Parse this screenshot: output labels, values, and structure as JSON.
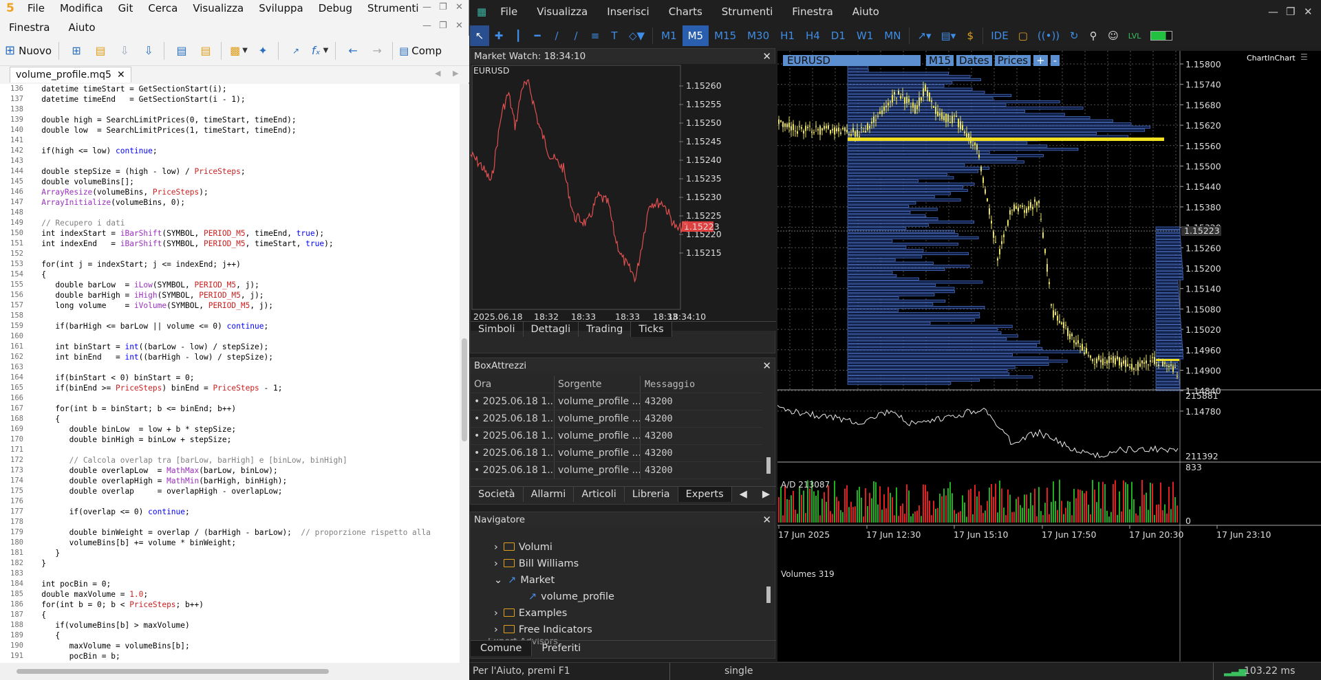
{
  "editor": {
    "logo": "5",
    "menu": [
      "File",
      "Modifica",
      "Git",
      "Cerca",
      "Visualizza",
      "Sviluppa",
      "Debug",
      "Strumenti"
    ],
    "menu2": [
      "Finestra",
      "Aiuto"
    ],
    "toolbar": {
      "new_label": "Nuovo",
      "compile_label": "Comp"
    },
    "file_tab": "volume_profile.mq5",
    "lines": [
      {
        "n": "136",
        "t": [
          [
            "",
            "   datetime timeStart = GetSectionStart(i);"
          ]
        ]
      },
      {
        "n": "137",
        "t": [
          [
            "",
            "   datetime timeEnd   = GetSectionStart(i - 1);"
          ]
        ]
      },
      {
        "n": "138",
        "t": []
      },
      {
        "n": "139",
        "t": [
          [
            "",
            "   double high = SearchLimitPrices(0, timeStart, timeEnd);"
          ]
        ]
      },
      {
        "n": "140",
        "t": [
          [
            "",
            "   double low  = SearchLimitPrices(1, timeStart, timeEnd);"
          ]
        ]
      },
      {
        "n": "141",
        "t": []
      },
      {
        "n": "142",
        "t": [
          [
            "",
            "   if(high <= low) "
          ],
          [
            "kw",
            "continue"
          ],
          [
            "",
            ";"
          ]
        ]
      },
      {
        "n": "143",
        "t": []
      },
      {
        "n": "144",
        "t": [
          [
            "",
            "   double stepSize = (high - low) / "
          ],
          [
            "cn",
            "PriceSteps"
          ],
          [
            "",
            ";"
          ]
        ]
      },
      {
        "n": "145",
        "t": [
          [
            "",
            "   double volumeBins[];"
          ]
        ]
      },
      {
        "n": "146",
        "t": [
          [
            "fn",
            "   ArrayResize"
          ],
          [
            "",
            "(volumeBins, "
          ],
          [
            "cn",
            "PriceSteps"
          ],
          [
            "",
            ");"
          ]
        ]
      },
      {
        "n": "147",
        "t": [
          [
            "fn",
            "   ArrayInitialize"
          ],
          [
            "",
            "(volumeBins, 0);"
          ]
        ]
      },
      {
        "n": "148",
        "t": []
      },
      {
        "n": "149",
        "t": [
          [
            "cm",
            "   // Recupero i dati"
          ]
        ]
      },
      {
        "n": "150",
        "t": [
          [
            "",
            "   int indexStart = "
          ],
          [
            "fn",
            "iBarShift"
          ],
          [
            "",
            "(SYMBOL, "
          ],
          [
            "cn",
            "PERIOD_M5"
          ],
          [
            "",
            ", timeEnd, "
          ],
          [
            "kw",
            "true"
          ],
          [
            "",
            ");"
          ]
        ]
      },
      {
        "n": "151",
        "t": [
          [
            "",
            "   int indexEnd   = "
          ],
          [
            "fn",
            "iBarShift"
          ],
          [
            "",
            "(SYMBOL, "
          ],
          [
            "cn",
            "PERIOD_M5"
          ],
          [
            "",
            ", timeStart, "
          ],
          [
            "kw",
            "true"
          ],
          [
            "",
            ");"
          ]
        ]
      },
      {
        "n": "152",
        "t": []
      },
      {
        "n": "153",
        "t": [
          [
            "",
            "   for(int j = indexStart; j <= indexEnd; j++)"
          ]
        ]
      },
      {
        "n": "154",
        "t": [
          [
            "",
            "   {"
          ]
        ]
      },
      {
        "n": "155",
        "t": [
          [
            "",
            "      double barLow  = "
          ],
          [
            "fn",
            "iLow"
          ],
          [
            "",
            "(SYMBOL, "
          ],
          [
            "cn",
            "PERIOD_M5"
          ],
          [
            "",
            ", j);"
          ]
        ]
      },
      {
        "n": "156",
        "t": [
          [
            "",
            "      double barHigh = "
          ],
          [
            "fn",
            "iHigh"
          ],
          [
            "",
            "(SYMBOL, "
          ],
          [
            "cn",
            "PERIOD_M5"
          ],
          [
            "",
            ", j);"
          ]
        ]
      },
      {
        "n": "157",
        "t": [
          [
            "",
            "      long volume    = "
          ],
          [
            "fn",
            "iVolume"
          ],
          [
            "",
            "(SYMBOL, "
          ],
          [
            "cn",
            "PERIOD_M5"
          ],
          [
            "",
            ", j);"
          ]
        ]
      },
      {
        "n": "158",
        "t": []
      },
      {
        "n": "159",
        "t": [
          [
            "",
            "      if(barHigh <= barLow || volume <= 0) "
          ],
          [
            "kw",
            "continue"
          ],
          [
            "",
            ";"
          ]
        ]
      },
      {
        "n": "160",
        "t": []
      },
      {
        "n": "161",
        "t": [
          [
            "",
            "      int binStart = "
          ],
          [
            "kw",
            "int"
          ],
          [
            "",
            "((barLow - low) / stepSize);"
          ]
        ]
      },
      {
        "n": "162",
        "t": [
          [
            "",
            "      int binEnd   = "
          ],
          [
            "kw",
            "int"
          ],
          [
            "",
            "((barHigh - low) / stepSize);"
          ]
        ]
      },
      {
        "n": "163",
        "t": []
      },
      {
        "n": "164",
        "t": [
          [
            "",
            "      if(binStart < 0) binStart = 0;"
          ]
        ]
      },
      {
        "n": "165",
        "t": [
          [
            "",
            "      if(binEnd >= "
          ],
          [
            "cn",
            "PriceSteps"
          ],
          [
            "",
            ") binEnd = "
          ],
          [
            "cn",
            "PriceSteps"
          ],
          [
            "",
            " - 1;"
          ]
        ]
      },
      {
        "n": "166",
        "t": []
      },
      {
        "n": "167",
        "t": [
          [
            "",
            "      for(int b = binStart; b <= binEnd; b++)"
          ]
        ]
      },
      {
        "n": "168",
        "t": [
          [
            "",
            "      {"
          ]
        ]
      },
      {
        "n": "169",
        "t": [
          [
            "",
            "         double binLow  = low + b * stepSize;"
          ]
        ]
      },
      {
        "n": "170",
        "t": [
          [
            "",
            "         double binHigh = binLow + stepSize;"
          ]
        ]
      },
      {
        "n": "171",
        "t": []
      },
      {
        "n": "172",
        "t": [
          [
            "cm",
            "         // Calcola overlap tra [barLow, barHigh] e [binLow, binHigh]"
          ]
        ]
      },
      {
        "n": "173",
        "t": [
          [
            "",
            "         double overlapLow  = "
          ],
          [
            "fn",
            "MathMax"
          ],
          [
            "",
            "(barLow, binLow);"
          ]
        ]
      },
      {
        "n": "174",
        "t": [
          [
            "",
            "         double overlapHigh = "
          ],
          [
            "fn",
            "MathMin"
          ],
          [
            "",
            "(barHigh, binHigh);"
          ]
        ]
      },
      {
        "n": "175",
        "t": [
          [
            "",
            "         double overlap     = overlapHigh - overlapLow;"
          ]
        ]
      },
      {
        "n": "176",
        "t": []
      },
      {
        "n": "177",
        "t": [
          [
            "",
            "         if(overlap <= 0) "
          ],
          [
            "kw",
            "continue"
          ],
          [
            "",
            ";"
          ]
        ]
      },
      {
        "n": "178",
        "t": []
      },
      {
        "n": "179",
        "t": [
          [
            "",
            "         double binWeight = overlap / (barHigh - barLow);  "
          ],
          [
            "cm",
            "// proporzione rispetto alla"
          ]
        ]
      },
      {
        "n": "180",
        "t": [
          [
            "",
            "         volumeBins[b] += volume * binWeight;"
          ]
        ]
      },
      {
        "n": "181",
        "t": [
          [
            "",
            "      }"
          ]
        ]
      },
      {
        "n": "182",
        "t": [
          [
            "",
            "   }"
          ]
        ]
      },
      {
        "n": "183",
        "t": []
      },
      {
        "n": "184",
        "t": [
          [
            "",
            "   int pocBin = 0;"
          ]
        ]
      },
      {
        "n": "185",
        "t": [
          [
            "",
            "   double maxVolume = "
          ],
          [
            "cn",
            "1.0"
          ],
          [
            "",
            ";"
          ]
        ]
      },
      {
        "n": "186",
        "t": [
          [
            "",
            "   for(int b = 0; b < "
          ],
          [
            "cn",
            "PriceSteps"
          ],
          [
            "",
            "; b++)"
          ]
        ]
      },
      {
        "n": "187",
        "t": [
          [
            "",
            "   {"
          ]
        ]
      },
      {
        "n": "188",
        "t": [
          [
            "",
            "      if(volumeBins[b] > maxVolume)"
          ]
        ]
      },
      {
        "n": "189",
        "t": [
          [
            "",
            "      {"
          ]
        ]
      },
      {
        "n": "190",
        "t": [
          [
            "",
            "         maxVolume = volumeBins[b];"
          ]
        ]
      },
      {
        "n": "191",
        "t": [
          [
            "",
            "         pocBin = b;"
          ]
        ]
      }
    ]
  },
  "mt": {
    "menu": [
      "File",
      "Visualizza",
      "Inserisci",
      "Charts",
      "Strumenti",
      "Finestra",
      "Aiuto"
    ],
    "timeframes": [
      "M1",
      "M5",
      "M15",
      "M30",
      "H1",
      "H4",
      "D1",
      "W1",
      "MN"
    ],
    "selected_tf": "M5",
    "ide_label": "IDE",
    "market_watch": {
      "title": "Market Watch: 18:34:10",
      "symbol": "EURUSD",
      "prices": [
        "1.15260",
        "1.15255",
        "1.15250",
        "1.15245",
        "1.15240",
        "1.15235",
        "1.15230",
        "1.15225",
        "1.15220",
        "1.15215"
      ],
      "current": "1.15223",
      "times": [
        "2025.06.18",
        "18:32",
        "18:33",
        "18:33",
        "18:33",
        "18:34:10"
      ],
      "tabs": [
        "Simboli",
        "Dettagli",
        "Trading",
        "Ticks"
      ],
      "active_tab": "Ticks"
    },
    "toolbox": {
      "title": "BoxAttrezzi",
      "headers": [
        "Ora",
        "Sorgente",
        "Messaggio"
      ],
      "rows": [
        [
          "2025.06.18 1...",
          "volume_profile ...",
          "43200"
        ],
        [
          "2025.06.18 1...",
          "volume_profile ...",
          "43200"
        ],
        [
          "2025.06.18 1...",
          "volume_profile ...",
          "43200"
        ],
        [
          "2025.06.18 1...",
          "volume_profile ...",
          "43200"
        ],
        [
          "2025.06.18 1...",
          "volume_profile ...",
          "43200"
        ]
      ],
      "tabs": [
        "Società",
        "Allarmi",
        "Articoli",
        "Libreria",
        "Experts"
      ]
    },
    "navigator": {
      "title": "Navigatore",
      "items": [
        "Volumi",
        "Bill Williams",
        "Market",
        "volume_profile",
        "Examples",
        "Free Indicators",
        "Expert Advisors"
      ],
      "tabs": [
        "Comune",
        "Preferiti"
      ]
    },
    "chart": {
      "symbol": "EURUSD",
      "timeframe": "M15",
      "buttons": [
        "Dates",
        "Prices",
        "+",
        "-"
      ],
      "brand": "ChartInChart",
      "price_labels": [
        "1.15800",
        "1.15740",
        "1.15680",
        "1.15620",
        "1.15560",
        "1.15500",
        "1.15440",
        "1.15380",
        "1.15320",
        "1.15260",
        "1.15200",
        "1.15140",
        "1.15080",
        "1.15020",
        "1.14960",
        "1.14900",
        "1.14840",
        "1.14780"
      ],
      "current_price": "1.15223",
      "ad_label": "A/D 213087",
      "ad_max": "215881",
      "ad_min": "211392",
      "vol_label": "Volumes 319",
      "vol_max": "833",
      "vol_min": "0",
      "time_labels": [
        "17 Jun 2025",
        "17 Jun 12:30",
        "17 Jun 15:10",
        "17 Jun 17:50",
        "17 Jun 20:30",
        "17 Jun 23:10"
      ]
    },
    "status": {
      "help": "Per l'Aiuto, premi F1",
      "profile": "single",
      "ping": "103.22 ms"
    }
  }
}
